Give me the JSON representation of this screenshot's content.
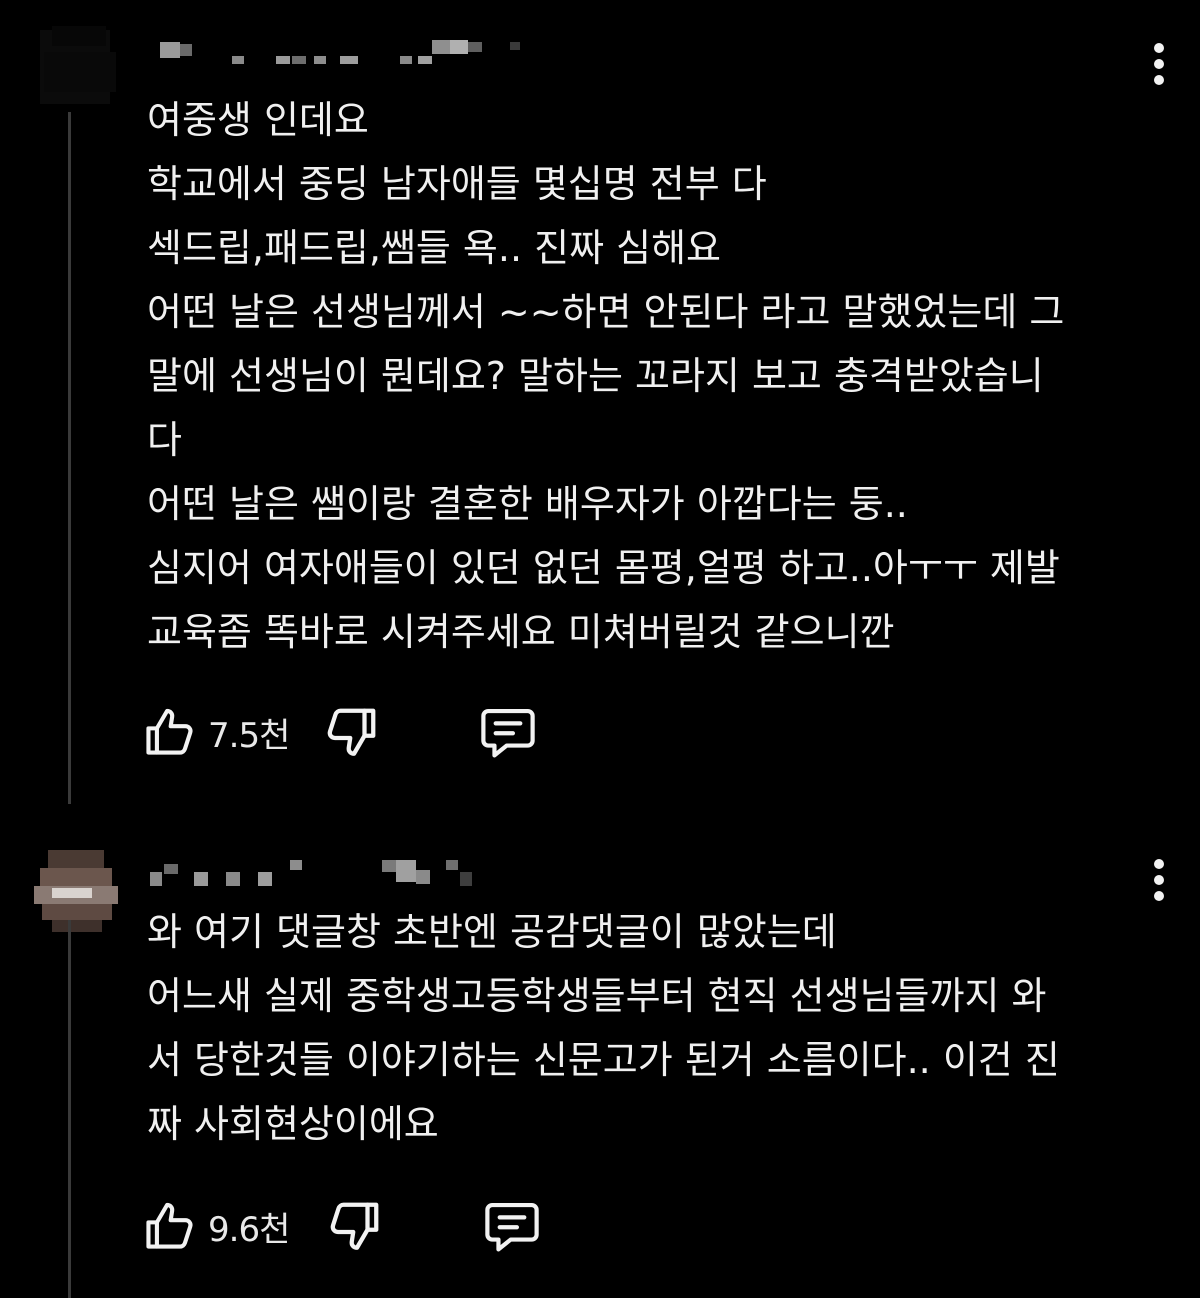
{
  "colors": {
    "background": "#000000",
    "text": "#f0f0f0",
    "icon": "#f2f2f2",
    "thread_line": "#3a3a3a"
  },
  "comments": [
    {
      "avatar": "blurred-avatar",
      "username": "pixelated-username",
      "lines": [
        "여중생 인데요",
        "학교에서 중딩 남자애들 몇십명 전부 다",
        "섹드립,패드립,쌤들 욕.. 진짜 심해요",
        "어떤 날은 선생님께서 ~~하면 안된다 라고 말했었는데 그",
        "말에 선생님이 뭔데요? 말하는 꼬라지 보고 충격받았습니",
        "다",
        "어떤 날은 쌤이랑 결혼한 배우자가 아깝다는 둥..",
        "심지어 여자애들이 있던 없던 몸평,얼평 하고..아ㅜㅜ 제발",
        "교육좀 똑바로 시켜주세요 미쳐버릴것 같으니깐"
      ],
      "like_count": "7.5천",
      "icons": {
        "like": "thumbs-up-icon",
        "dislike": "thumbs-down-icon",
        "reply": "reply-icon",
        "menu": "more-vertical-icon"
      }
    },
    {
      "avatar": "blurred-avatar",
      "username": "pixelated-username",
      "lines": [
        "와 여기 댓글창 초반엔 공감댓글이 많았는데",
        "어느새 실제 중학생고등학생들부터 현직 선생님들까지 와",
        "서 당한것들 이야기하는 신문고가 된거 소름이다.. 이건 진",
        "짜 사회현상이에요"
      ],
      "like_count": "9.6천",
      "icons": {
        "like": "thumbs-up-icon",
        "dislike": "thumbs-down-icon",
        "reply": "reply-icon",
        "menu": "more-vertical-icon"
      }
    }
  ]
}
